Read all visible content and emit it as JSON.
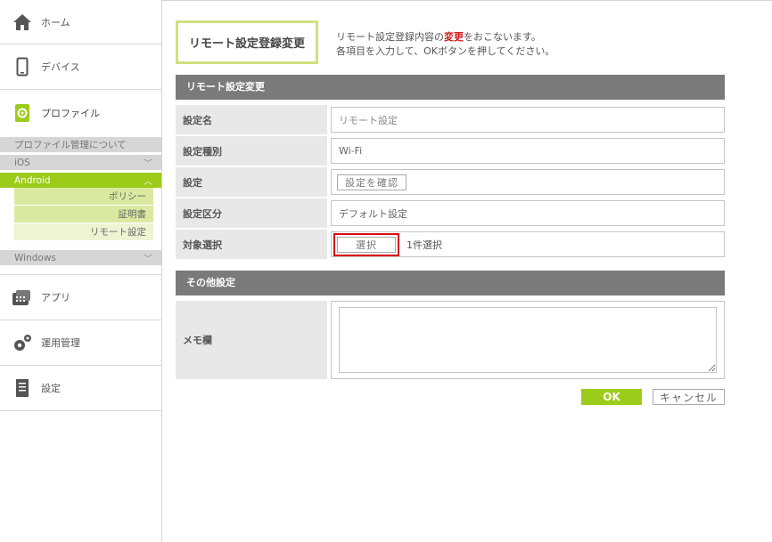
{
  "sidebar": {
    "home": "ホーム",
    "devices": "デバイス",
    "profile": "プロファイル",
    "profile_about": "プロファイル管理について",
    "ios": "iOS",
    "android": "Android",
    "android_items": [
      "ポリシー",
      "証明書",
      "リモート設定"
    ],
    "windows": "Windows",
    "apps": "アプリ",
    "operations": "運用管理",
    "settings": "設定"
  },
  "page": {
    "title": "リモート設定登録変更",
    "desc_line1_pre": "リモート設定登録内容の",
    "desc_line1_red": "変更",
    "desc_line1_post": "をおこないます。",
    "desc_line2": "各項目を入力して、OKボタンを押してください。"
  },
  "form": {
    "section1": "リモート設定変更",
    "rows": {
      "name_label": "設定名",
      "name_placeholder": "リモート設定",
      "type_label": "設定種別",
      "type_value": "Wi-Fi",
      "setting_label": "設定",
      "setting_button": "設定を確認",
      "category_label": "設定区分",
      "category_value": "デフォルト設定",
      "target_label": "対象選択",
      "target_button": "選択",
      "target_count": "1件選択"
    },
    "section2": "その他設定",
    "memo_label": "メモ欄",
    "ok": "OK",
    "cancel": "キャンセル"
  },
  "colors": {
    "accent": "#9ccb1a",
    "header_gray": "#7a7a7a",
    "highlight_red": "#d80f0f"
  }
}
